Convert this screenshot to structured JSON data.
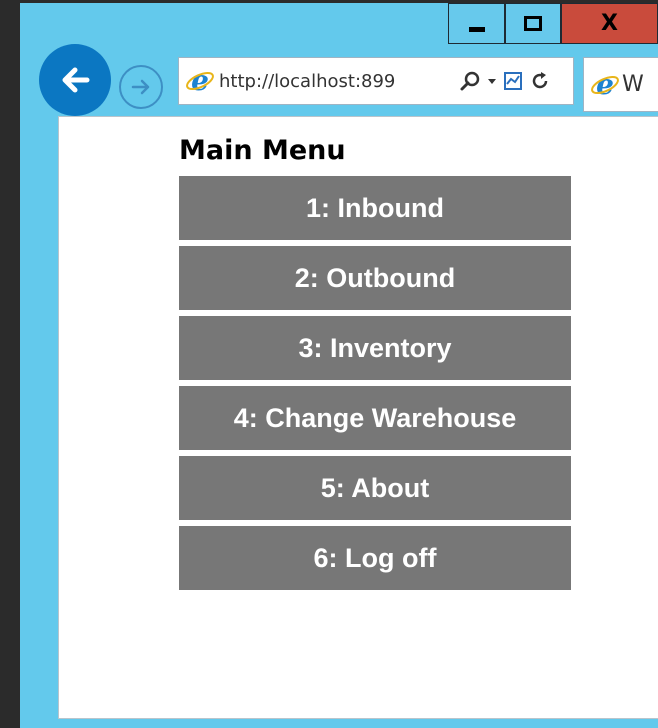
{
  "browser": {
    "address_url": "http://localhost:899",
    "tab_title": "W"
  },
  "page": {
    "title": "Main Menu",
    "menu_items": [
      {
        "label": "1: Inbound"
      },
      {
        "label": "2: Outbound"
      },
      {
        "label": "3: Inventory"
      },
      {
        "label": "4: Change Warehouse"
      },
      {
        "label": "5: About"
      },
      {
        "label": "6: Log off"
      }
    ]
  },
  "colors": {
    "window_frame": "#63c9ec",
    "close_button": "#c94b3c",
    "back_button": "#0b77c2",
    "menu_button_bg": "#777777",
    "menu_button_text": "#ffffff"
  },
  "icons": {
    "minimize": "minimize-icon",
    "maximize": "maximize-icon",
    "close": "close-icon",
    "back": "back-arrow-icon",
    "forward": "forward-arrow-icon",
    "ie": "internet-explorer-icon",
    "search": "search-icon",
    "dropdown": "chevron-down-icon",
    "compat": "compatibility-view-icon",
    "refresh": "refresh-icon"
  }
}
